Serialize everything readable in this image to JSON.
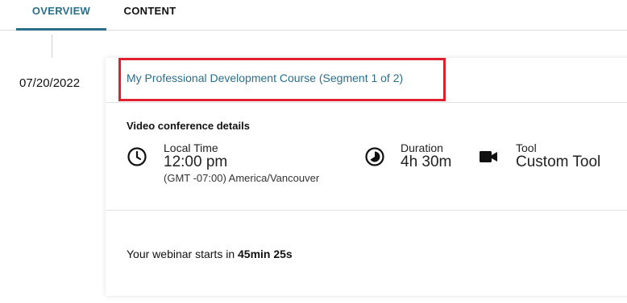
{
  "tabs": {
    "overview": "OVERVIEW",
    "content": "CONTENT"
  },
  "session": {
    "date": "07/20/2022",
    "title": "My Professional Development Course (Segment 1 of 2)"
  },
  "details": {
    "section_label": "Video conference details",
    "local_time_label": "Local Time",
    "local_time_value": "12:00 pm",
    "timezone": "(GMT -07:00) America/Vancouver",
    "duration_label": "Duration",
    "duration_value": "4h 30m",
    "tool_label": "Tool",
    "tool_value": "Custom Tool"
  },
  "countdown": {
    "prefix": "Your webinar starts in ",
    "value": "45min 25s"
  },
  "colors": {
    "accent": "#2b6e89",
    "highlight_border": "#e0202e"
  },
  "icons": {
    "time": "clock-icon",
    "duration": "pie-clock-icon",
    "tool": "video-camera-icon"
  }
}
